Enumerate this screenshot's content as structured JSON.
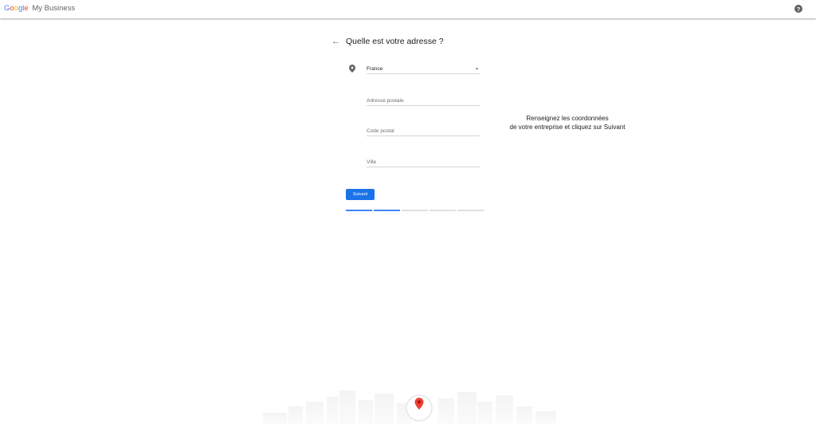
{
  "header": {
    "logo_google": [
      "G",
      "o",
      "o",
      "g",
      "l",
      "e"
    ],
    "product": "My Business",
    "help_icon": "help-circle-icon"
  },
  "form": {
    "title": "Quelle est votre adresse ?",
    "country": "France",
    "street_placeholder": "Adresse postale",
    "postal_placeholder": "Code postal",
    "city_placeholder": "Ville",
    "next_label": "Suivant"
  },
  "progress": {
    "total_steps": 5,
    "completed_steps": 2
  },
  "hint": {
    "line1": "Renseignez les coordonnées",
    "line2": "de votre entreprise et cliquez sur Suivant"
  },
  "colors": {
    "primary": "#1a73e8",
    "progress": "#4285f4",
    "pin": "#ea4335"
  }
}
